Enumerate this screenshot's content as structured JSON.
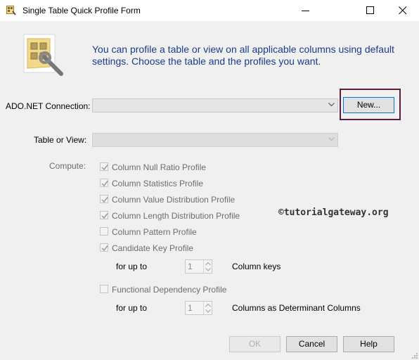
{
  "window": {
    "title": "Single Table Quick Profile Form"
  },
  "intro_text": "You can profile a table or view on all applicable columns using default settings. Choose the table and the profiles you want.",
  "connection": {
    "label": "ADO.NET Connection:",
    "value": "",
    "new_button": "New..."
  },
  "table": {
    "label": "Table or View:",
    "value": ""
  },
  "compute": {
    "label": "Compute:",
    "profiles": [
      {
        "label": "Column Null Ratio Profile",
        "checked": true
      },
      {
        "label": "Column Statistics Profile",
        "checked": true
      },
      {
        "label": "Column Value Distribution Profile",
        "checked": true
      },
      {
        "label": "Column Length Distribution Profile",
        "checked": true
      },
      {
        "label": "Column Pattern Profile",
        "checked": false
      },
      {
        "label": "Candidate Key Profile",
        "checked": true
      }
    ],
    "key_for_up_to": "for up to",
    "key_value": "1",
    "key_suffix": "Column keys",
    "fd_profile": {
      "label": "Functional Dependency Profile",
      "checked": false
    },
    "fd_for_up_to": "for up to",
    "fd_value": "1",
    "fd_suffix": "Columns as Determinant Columns"
  },
  "watermark": "©tutorialgateway.org",
  "buttons": {
    "ok": "OK",
    "cancel": "Cancel",
    "help": "Help"
  },
  "colors": {
    "intro_text": "#1a3b8c",
    "highlight_border": "#5b1c3f",
    "disabled_text": "#6d6d6d"
  }
}
